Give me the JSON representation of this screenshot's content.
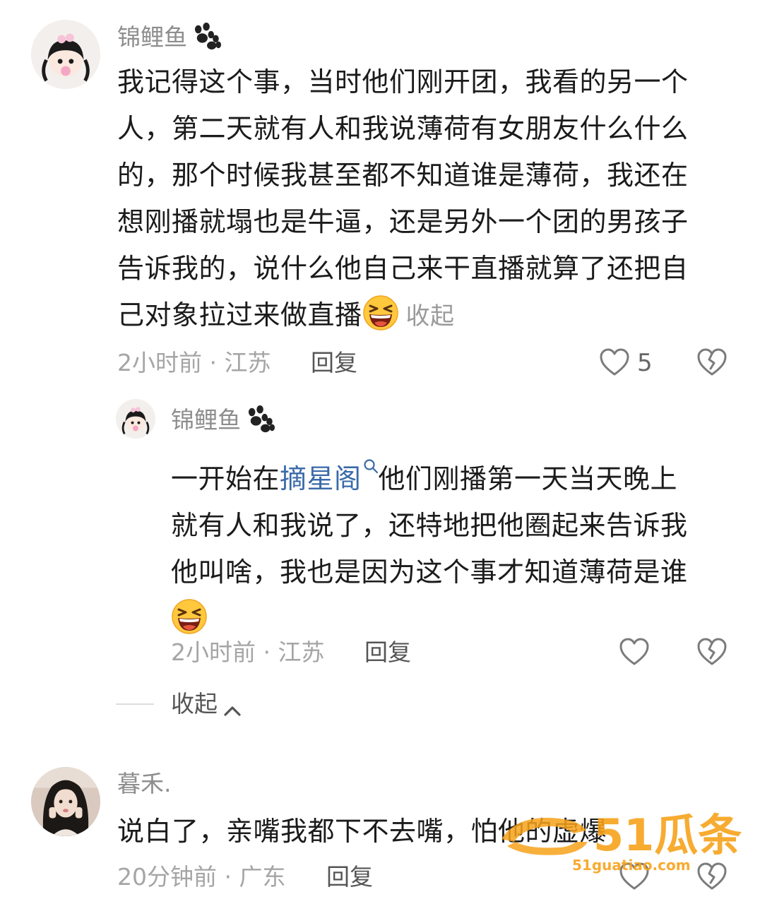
{
  "comments": [
    {
      "username": "锦鲤鱼",
      "text_lines": [
        "我记得这个事，当时他们刚开团，我看的另一个",
        "人，第二天就有人和我说薄荷有女朋友什么什么",
        "的，那个时候我甚至都不知道谁是薄荷，我还在",
        "想刚播就塌也是牛逼，还是另外一个团的男孩子",
        "告诉我的，说什么他自己来干直播就算了还把自",
        "己对象拉过来做直播"
      ],
      "collapse_label": "收起",
      "time_location": "2小时前 · 江苏",
      "reply_label": "回复",
      "like_count": "5"
    },
    {
      "username": "锦鲤鱼",
      "text_prefix": "一开始在",
      "link_text": "摘星阁",
      "text_line1_suffix": "他们刚播第一天当天晚上",
      "text_lines": [
        "就有人和我说了，还特地把他圈起来告诉我",
        "他叫啥，我也是因为这个事才知道薄荷是谁"
      ],
      "time_location": "2小时前 · 江苏",
      "reply_label": "回复",
      "collapse_thread_label": "收起"
    },
    {
      "username": "暮禾.",
      "text": "说白了，亲嘴我都下不去嘴，怕他的虚爆",
      "time_location": "20分钟前 · 广东",
      "reply_label": "回复"
    }
  ],
  "watermark": {
    "brand": "51瓜条",
    "url": "51guatiao.com"
  },
  "colors": {
    "username": "#8e8e8e",
    "meta": "#a5a5a5",
    "link": "#3a6aa8",
    "watermark": "#f7a21b"
  },
  "icons": [
    "paw-icon",
    "grin-squint-emoji",
    "heart-outline-icon",
    "broken-heart-icon",
    "search-icon",
    "chevron-up-icon"
  ]
}
